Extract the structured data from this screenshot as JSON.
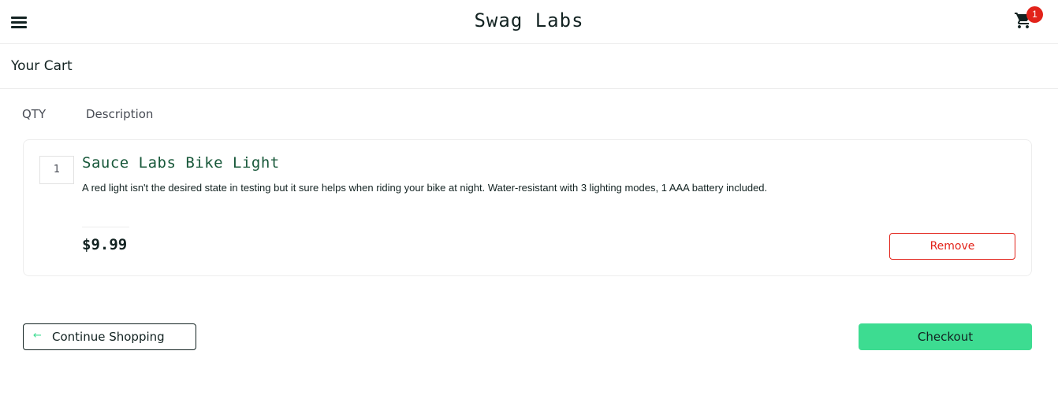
{
  "header": {
    "app_title": "Swag Labs",
    "cart_count": "1",
    "menu_icon": "hamburger-icon",
    "cart_icon": "shopping-cart-icon"
  },
  "subheader": {
    "title": "Your Cart"
  },
  "cart_list": {
    "qty_label": "QTY",
    "desc_label": "Description",
    "items": [
      {
        "quantity": "1",
        "name": "Sauce Labs Bike Light",
        "description": "A red light isn't the desired state in testing but it sure helps when riding your bike at night. Water-resistant with 3 lighting modes, 1 AAA battery included.",
        "price": "$9.99",
        "remove_label": "Remove"
      }
    ]
  },
  "footer_actions": {
    "continue_label": "Continue Shopping",
    "continue_icon": "arrow-left-icon",
    "checkout_label": "Checkout"
  },
  "colors": {
    "accent": "#3ddc91",
    "danger": "#e2231a",
    "item_title": "#18583a",
    "text": "#132322"
  }
}
